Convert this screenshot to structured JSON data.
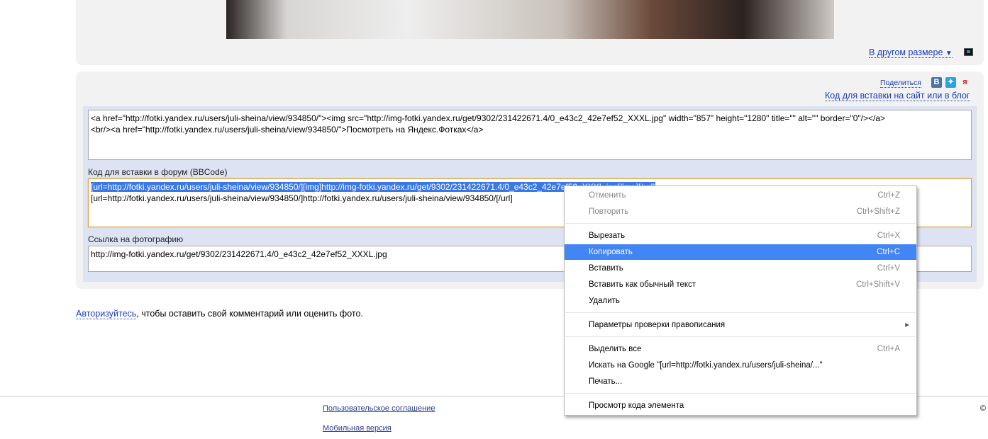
{
  "photo_panel": {
    "other_size_link": "В другом размере",
    "dropdown_arrow": "▼",
    "monitor_icon": "monitor-icon"
  },
  "share_panel": {
    "share_label": "Поделиться",
    "share_icons": [
      "vk-icon",
      "twitter-icon",
      "yaru-icon"
    ],
    "vk_letter": "B",
    "embed_link": "Код для вставки на сайт или в блог",
    "html_code": "<a href=\"http://fotki.yandex.ru/users/juli-sheina/view/934850/\"><img src=\"http://img-fotki.yandex.ru/get/9302/231422671.4/0_e43c2_42e7ef52_XXXL.jpg\" width=\"857\" height=\"1280\" title=\"\" alt=\"\" border=\"0\"/></a>\n<br/><a href=\"http://fotki.yandex.ru/users/juli-sheina/view/934850/\">Посмотреть на Яндекс.Фотках</a>",
    "bbcode_label": "Код для вставки в форум (BBCode)",
    "bbcode_line1": "[url=http://fotki.yandex.ru/users/juli-sheina/view/934850/][img]http://img-fotki.yandex.ru/get/9302/231422671.4/0_e43c2_42e7ef52_XXXL.jpg[/img][/url]",
    "bbcode_line2": "[url=http://fotki.yandex.ru/users/juli-sheina/view/934850/]http://fotki.yandex.ru/users/juli-sheina/view/934850/[/url]",
    "link_label": "Ссылка на фотографию",
    "link_value": "http://img-fotki.yandex.ru/get/9302/231422671.4/0_e43c2_42e7ef52_XXXL.jpg"
  },
  "comment": {
    "auth_link": "Авторизуйтесь",
    "rest": ", чтобы оставить свой комментарий или оценить фото."
  },
  "footer": {
    "agreement": "Пользовательское соглашение",
    "mobile": "Мобильная версия",
    "copyright": "©"
  },
  "context_menu": {
    "items": [
      {
        "label": "Отменить",
        "shortcut": "Ctrl+Z"
      },
      {
        "label": "Повторить",
        "shortcut": "Ctrl+Shift+Z"
      },
      {
        "label": "Вырезать",
        "shortcut": "Ctrl+X"
      },
      {
        "label": "Копировать",
        "shortcut": "Ctrl+C"
      },
      {
        "label": "Вставить",
        "shortcut": "Ctrl+V"
      },
      {
        "label": "Вставить как обычный текст",
        "shortcut": "Ctrl+Shift+V"
      },
      {
        "label": "Удалить",
        "shortcut": ""
      },
      {
        "label": "Параметры проверки правописания",
        "shortcut": "▸"
      },
      {
        "label": "Выделить все",
        "shortcut": "Ctrl+A"
      },
      {
        "label": "Искать на Google \"[url=http://fotki.yandex.ru/users/juli-sheina/...\"",
        "shortcut": ""
      },
      {
        "label": "Печать...",
        "shortcut": ""
      },
      {
        "label": "Просмотр кода элемента",
        "shortcut": ""
      }
    ]
  }
}
